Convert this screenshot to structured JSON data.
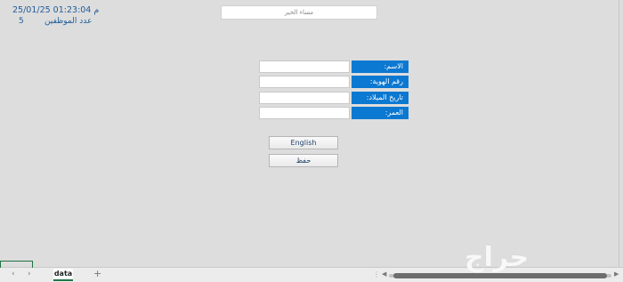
{
  "header": {
    "datetime": "25/01/25 01:23:04 م",
    "employee_count_label": "عدد الموظفين",
    "employee_count": "5"
  },
  "welcome": {
    "text": "مساء الخير"
  },
  "form": {
    "name_label": "الاسم:",
    "id_label": "رقم الهوية:",
    "birth_label": "تاريخ الميلاد:",
    "age_label": "العمر:",
    "name_value": "",
    "id_value": "",
    "birth_value": "",
    "age_value": ""
  },
  "buttons": {
    "english": "English",
    "save": "حفظ"
  },
  "status": {
    "sheet_tab": "data",
    "add_sheet": "+",
    "nav_prev": "‹",
    "nav_next": "›",
    "scroll_left": "◀",
    "scroll_right": "▶"
  },
  "watermark": {
    "text": "حراج"
  },
  "colors": {
    "label_bg": "#0b78d1",
    "text_blue": "#1f5c99",
    "sheet_bg": "#dddddd"
  }
}
